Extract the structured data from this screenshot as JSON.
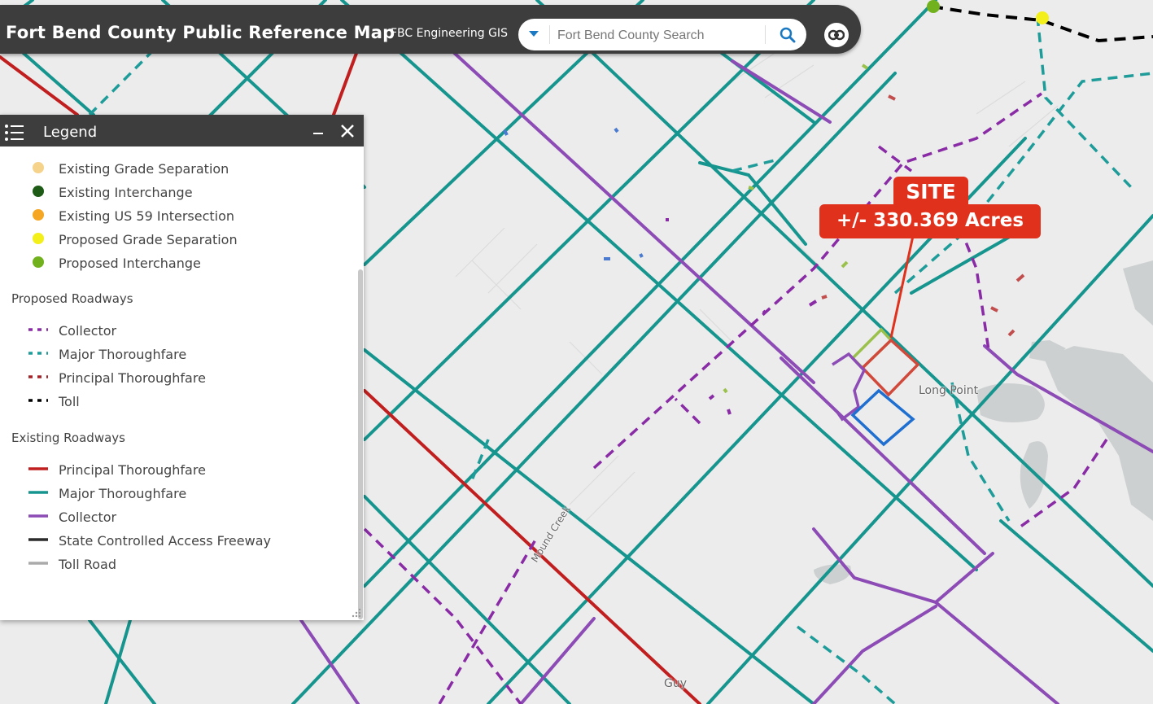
{
  "header": {
    "title": "Fort Bend County Public Reference Map",
    "subtitle": "FBC Engineering GIS",
    "search_placeholder": "Fort Bend County Search"
  },
  "legend": {
    "title": "Legend",
    "point_items": [
      {
        "label": "Existing Grade Separation",
        "color": "#f6d38a"
      },
      {
        "label": "Existing Interchange",
        "color": "#1e5b16"
      },
      {
        "label": "Existing US 59 Intersection",
        "color": "#f5a623"
      },
      {
        "label": "Proposed Grade Separation",
        "color": "#f2ef1a"
      },
      {
        "label": "Proposed Interchange",
        "color": "#72b11e"
      }
    ],
    "proposed_group": "Proposed Roadways",
    "proposed_items": [
      {
        "label": "Collector",
        "color": "#8a2ba6"
      },
      {
        "label": "Major Thoroughfare",
        "color": "#1e9c9a"
      },
      {
        "label": "Principal Thoroughfare",
        "color": "#a3232a"
      },
      {
        "label": "Toll",
        "color": "#000000"
      }
    ],
    "existing_group": "Existing Roadways",
    "existing_items": [
      {
        "label": "Principal Thoroughfare",
        "color": "#c11f1f"
      },
      {
        "label": "Major Thoroughfare",
        "color": "#16958f"
      },
      {
        "label": "Collector",
        "color": "#8c4bb5"
      },
      {
        "label": "State Controlled Access Freeway",
        "color": "#2b2b2b"
      },
      {
        "label": "Toll Road",
        "color": "#aaaaaa"
      }
    ]
  },
  "site": {
    "label": "SITE",
    "acres": "+/- 330.369 Acres"
  },
  "places": {
    "long_point": "Long Point",
    "mound_creek": "Mound Creek",
    "guy": "Guy"
  },
  "colors": {
    "map_bg": "#ececec",
    "teal": "#16958f",
    "purple": "#8c4bb5",
    "red": "#c11f1f",
    "callout": "#e0311c"
  }
}
